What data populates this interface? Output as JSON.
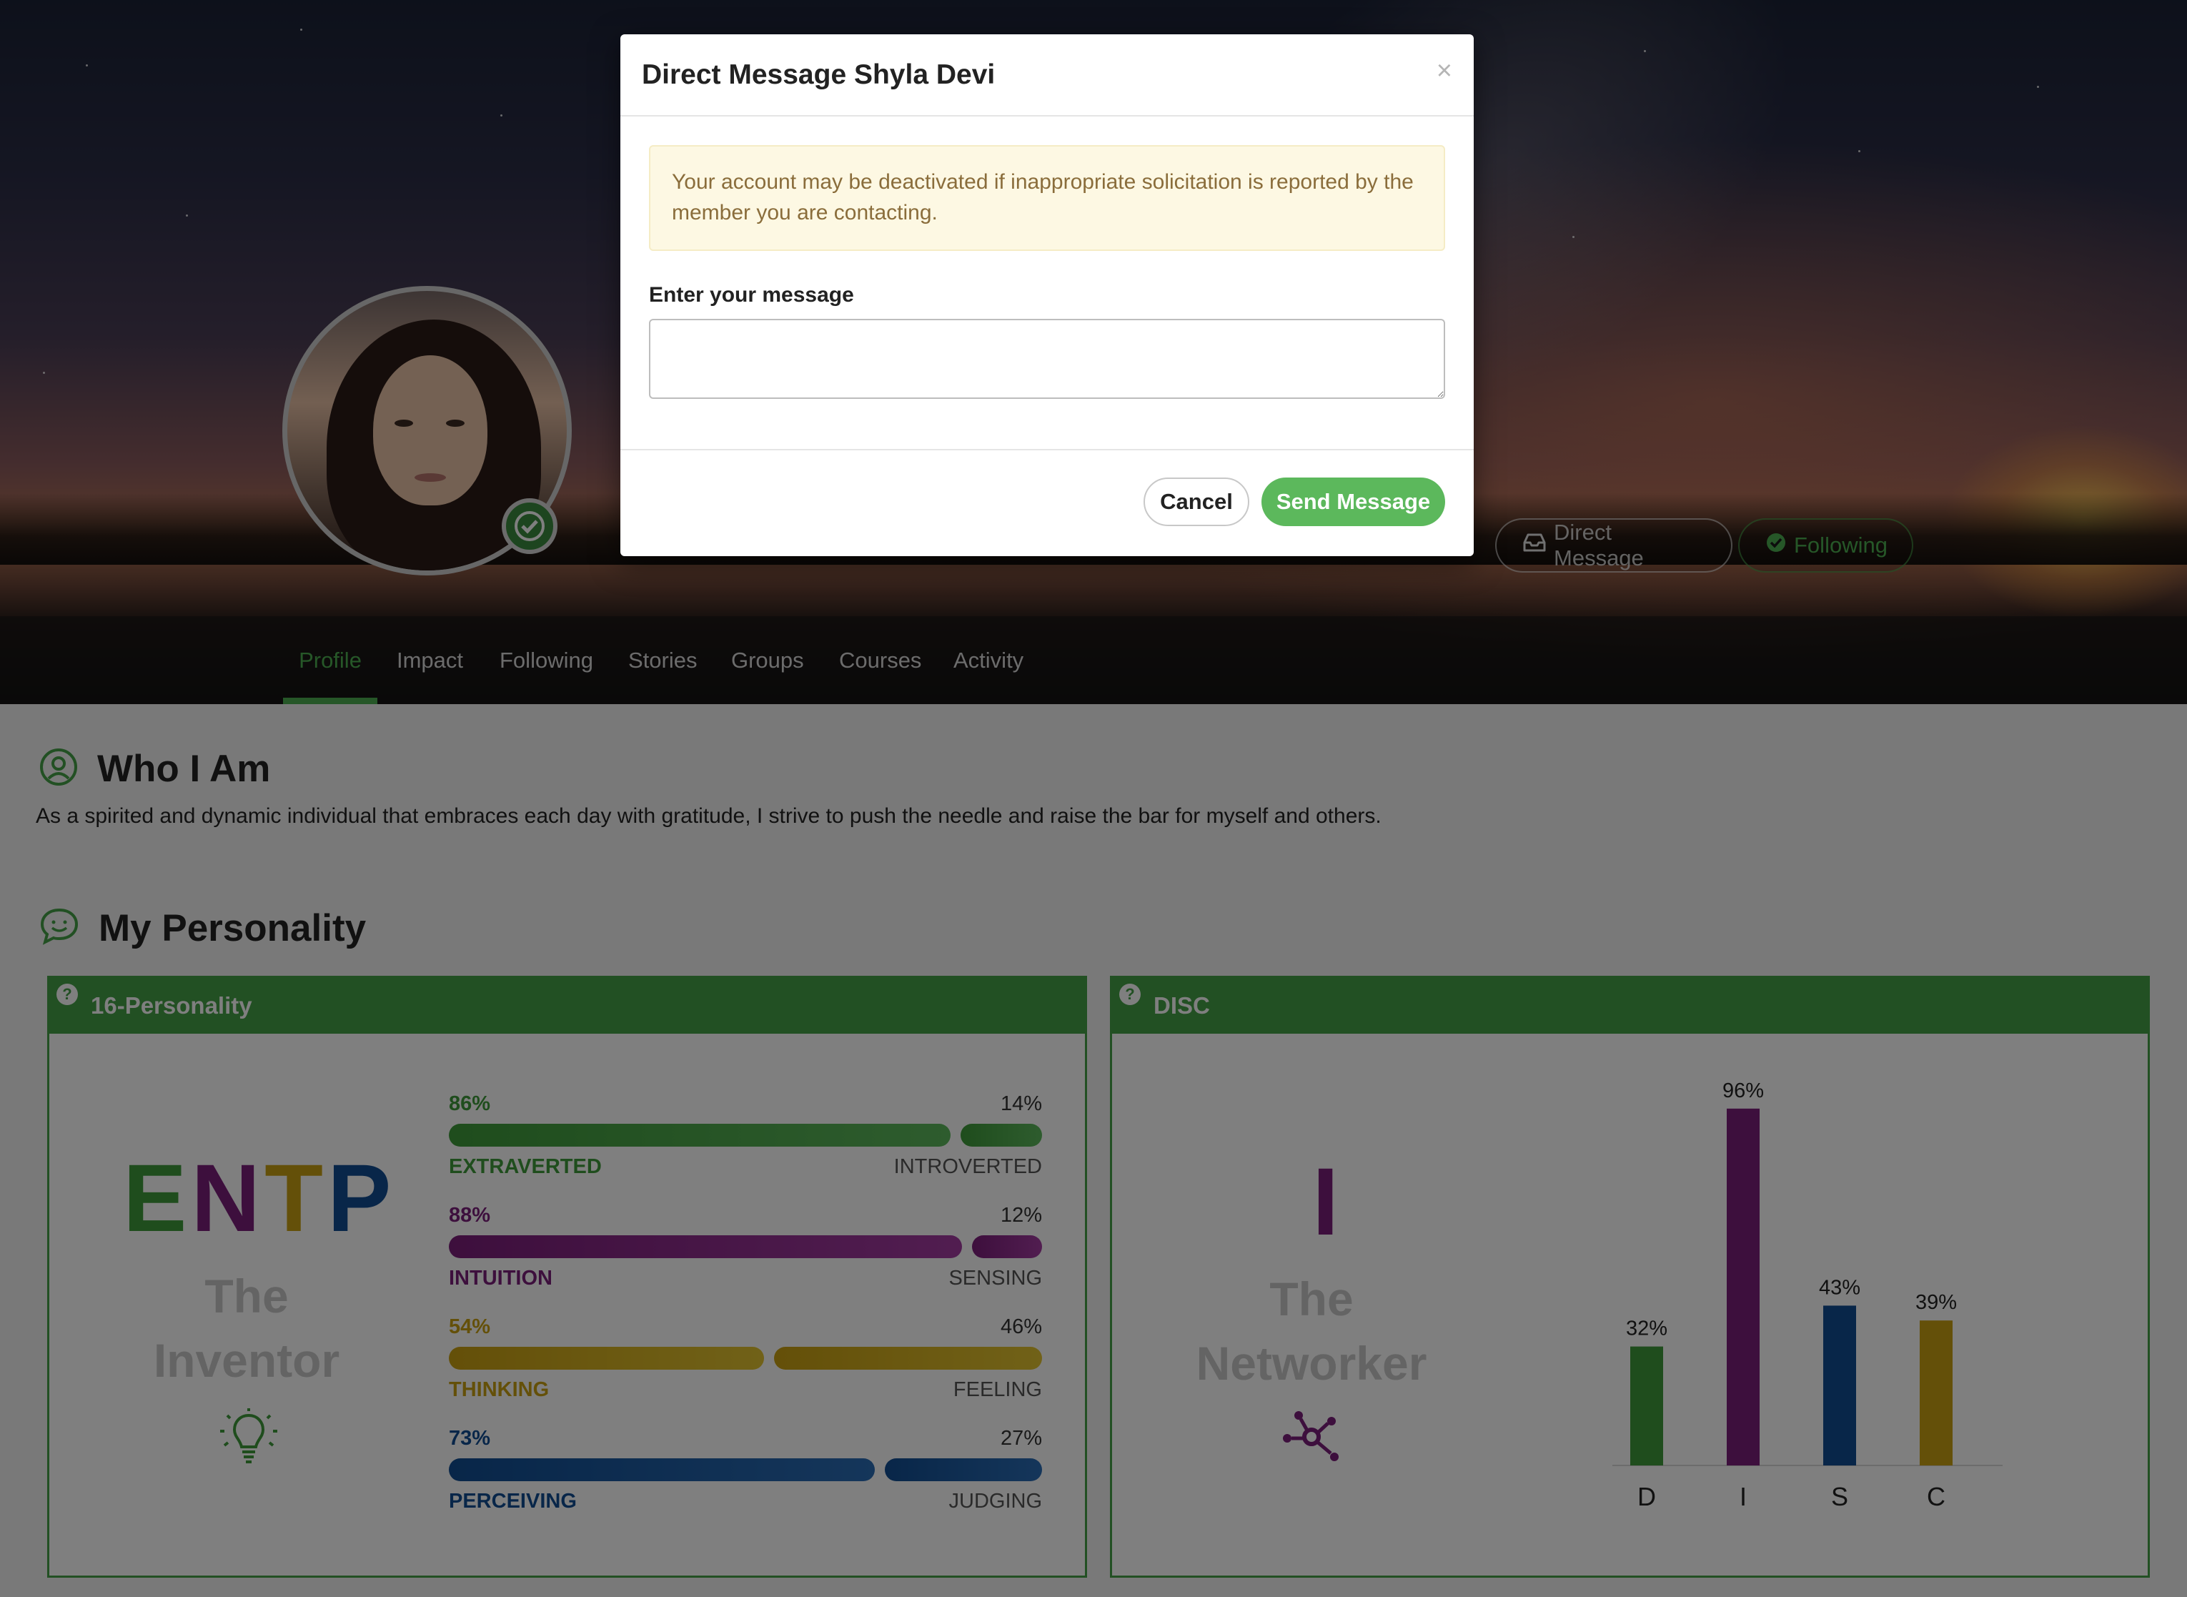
{
  "colors": {
    "brand_green": "#44a047",
    "extraverted": "#3e9a3a",
    "intuition": "#7b1e7a",
    "thinking": "#c9a012",
    "perceiving": "#114d92",
    "disc_d": "#3e9a3a",
    "disc_i": "#7b1e7a",
    "disc_s": "#114d92",
    "disc_c": "#c9a012"
  },
  "hero": {
    "dm_button": "Direct Message",
    "following_button": "Following"
  },
  "tabs": [
    "Profile",
    "Impact",
    "Following",
    "Stories",
    "Groups",
    "Courses",
    "Activity"
  ],
  "active_tab": "Profile",
  "who": {
    "title": "Who I Am",
    "text": "As a spirited and dynamic individual that embraces each day with gratitude, I strive to push the needle and raise the bar for myself and others."
  },
  "personality": {
    "title": "My Personality",
    "mbti_panel": {
      "title": "16-Personality",
      "help": "?",
      "letters": [
        "E",
        "N",
        "T",
        "P"
      ],
      "name_line1": "The",
      "name_line2": "Inventor",
      "icon": "lightbulb-icon",
      "traits": [
        {
          "left_pct": "86%",
          "right_pct": "14%",
          "left_label": "EXTRAVERTED",
          "right_label": "INTROVERTED",
          "value": 0.86
        },
        {
          "left_pct": "88%",
          "right_pct": "12%",
          "left_label": "INTUITION",
          "right_label": "SENSING",
          "value": 0.88
        },
        {
          "left_pct": "54%",
          "right_pct": "46%",
          "left_label": "THINKING",
          "right_label": "FEELING",
          "value": 0.54
        },
        {
          "left_pct": "73%",
          "right_pct": "27%",
          "left_label": "PERCEIVING",
          "right_label": "JUDGING",
          "value": 0.73
        }
      ]
    },
    "disc_panel": {
      "title": "DISC",
      "help": "?",
      "letter": "I",
      "name_line1": "The",
      "name_line2": "Networker",
      "icon": "network-icon"
    }
  },
  "chart_data": {
    "type": "bar",
    "categories": [
      "D",
      "I",
      "S",
      "C"
    ],
    "values": [
      32,
      96,
      43,
      39
    ],
    "data_labels": [
      "32%",
      "96%",
      "43%",
      "39%"
    ],
    "ylim": [
      0,
      100
    ],
    "grid": false
  },
  "modal": {
    "title": "Direct Message Shyla Devi",
    "close": "×",
    "alert": "Your account may be deactivated if inappropriate solicitation is reported by the member you are contacting.",
    "label": "Enter your message",
    "message_value": "",
    "cancel": "Cancel",
    "send": "Send Message"
  }
}
